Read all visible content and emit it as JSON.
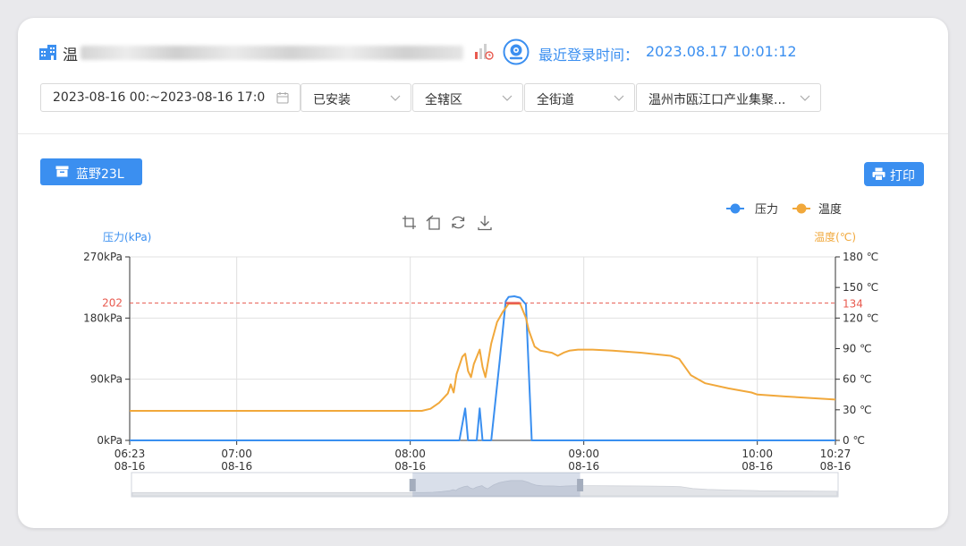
{
  "header": {
    "org_char": "温",
    "login_label": "最近登录时间：",
    "login_time": "2023.08.17 10:01:12"
  },
  "filters": {
    "date_range": "2023-08-16 00:~2023-08-16 17:0",
    "install_status": "已安装",
    "district": "全辖区",
    "street": "全街道",
    "organization": "温州市瓯江口产业集聚..."
  },
  "device_button_label": "蓝野23L",
  "print_button_label": "打印",
  "icons": [
    "building-icon",
    "signal-icon",
    "camera-icon",
    "calendar-icon",
    "chevron-down-icon",
    "device-icon",
    "printer-icon",
    "crop-icon",
    "undo-icon",
    "refresh-icon",
    "download-icon"
  ],
  "colors": {
    "accent": "#3b8ff0",
    "pressure": "#3a8ff0",
    "temperature": "#f1a83b",
    "threshold": "#e85a4f"
  },
  "chart_data": {
    "type": "line",
    "legend": {
      "position": "top-right",
      "items": [
        "压力",
        "温度"
      ]
    },
    "y_left": {
      "label": "压力(kPa)",
      "min": 0,
      "max": 270,
      "ticks": [
        "0kPa",
        "90kPa",
        "180kPa",
        "270kPa"
      ],
      "tick_values": [
        0,
        90,
        180,
        270
      ]
    },
    "y_right": {
      "label": "温度(℃)",
      "min": 0,
      "max": 180,
      "ticks": [
        "0 ℃",
        "30 ℃",
        "60 ℃",
        "90 ℃",
        "120 ℃",
        "150 ℃",
        "180 ℃"
      ],
      "tick_values": [
        0,
        30,
        60,
        90,
        120,
        150,
        180
      ]
    },
    "x_range": [
      "06:23",
      "10:27"
    ],
    "x_ticks": [
      {
        "t": "06:23",
        "time": "06:23",
        "date": "08-16"
      },
      {
        "t": "07:00",
        "time": "07:00",
        "date": "08-16"
      },
      {
        "t": "08:00",
        "time": "08:00",
        "date": "08-16"
      },
      {
        "t": "09:00",
        "time": "09:00",
        "date": "08-16"
      },
      {
        "t": "10:00",
        "time": "10:00",
        "date": "08-16"
      },
      {
        "t": "10:27",
        "time": "10:27",
        "date": "08-16"
      }
    ],
    "thresholds": {
      "pressure": 202,
      "pressure_label": "202",
      "temperature": 134,
      "temperature_label": "134"
    },
    "series": [
      {
        "name": "压力",
        "axis": "left",
        "points": [
          [
            "06:23",
            0
          ],
          [
            "08:02",
            0
          ],
          [
            "08:10",
            0
          ],
          [
            "08:15",
            0
          ],
          [
            "08:17",
            0
          ],
          [
            "08:19",
            47
          ],
          [
            "08:20",
            0
          ],
          [
            "08:23",
            0
          ],
          [
            "08:24",
            47
          ],
          [
            "08:25",
            0
          ],
          [
            "08:28",
            0
          ],
          [
            "08:31",
            120
          ],
          [
            "08:33",
            205
          ],
          [
            "08:34",
            211
          ],
          [
            "08:36",
            212
          ],
          [
            "08:38",
            210
          ],
          [
            "08:40",
            200
          ],
          [
            "08:42",
            0
          ],
          [
            "10:27",
            0
          ]
        ]
      },
      {
        "name": "温度",
        "axis": "right",
        "points": [
          [
            "06:23",
            29
          ],
          [
            "08:04",
            29
          ],
          [
            "08:07",
            31
          ],
          [
            "08:10",
            37
          ],
          [
            "08:13",
            46
          ],
          [
            "08:14",
            55
          ],
          [
            "08:15",
            47
          ],
          [
            "08:16",
            65
          ],
          [
            "08:18",
            82
          ],
          [
            "08:19",
            85
          ],
          [
            "08:20",
            68
          ],
          [
            "08:21",
            62
          ],
          [
            "08:22",
            75
          ],
          [
            "08:24",
            89
          ],
          [
            "08:25",
            72
          ],
          [
            "08:26",
            62
          ],
          [
            "08:28",
            95
          ],
          [
            "08:30",
            116
          ],
          [
            "08:32",
            126
          ],
          [
            "08:34",
            134
          ],
          [
            "08:36",
            134
          ],
          [
            "08:38",
            134
          ],
          [
            "08:40",
            120
          ],
          [
            "08:41",
            108
          ],
          [
            "08:43",
            92
          ],
          [
            "08:45",
            88
          ],
          [
            "08:49",
            86
          ],
          [
            "08:51",
            83
          ],
          [
            "08:53",
            86
          ],
          [
            "08:55",
            88
          ],
          [
            "08:58",
            89
          ],
          [
            "09:03",
            89
          ],
          [
            "09:10",
            88
          ],
          [
            "09:20",
            86
          ],
          [
            "09:30",
            83
          ],
          [
            "09:33",
            80
          ],
          [
            "09:37",
            64
          ],
          [
            "09:42",
            56
          ],
          [
            "09:50",
            51
          ],
          [
            "09:58",
            47
          ],
          [
            "10:00",
            45
          ],
          [
            "10:10",
            43
          ],
          [
            "10:27",
            40
          ]
        ]
      }
    ],
    "data_zoom": {
      "start": "08:00",
      "end": "08:58"
    }
  }
}
